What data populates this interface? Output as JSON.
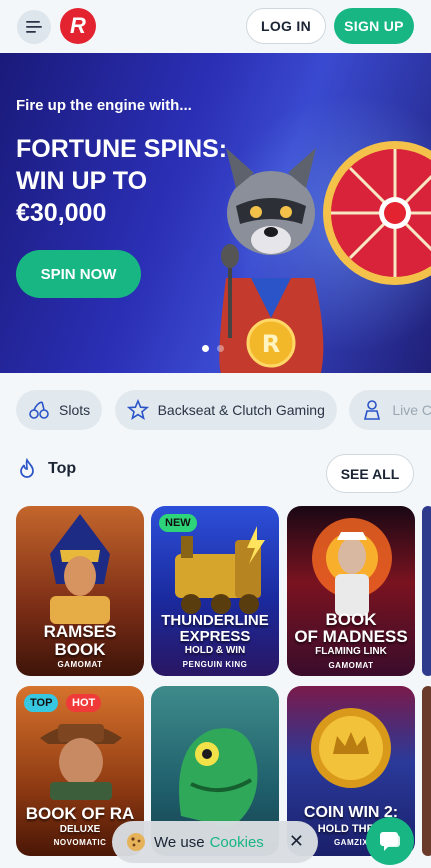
{
  "header": {
    "login_label": "LOG IN",
    "signup_label": "SIGN UP"
  },
  "hero": {
    "subtitle": "Fire up the engine with...",
    "title_line1": "FORTUNE SPINS:",
    "title_line2": "WIN UP TO",
    "title_line3": "€30,000",
    "cta_label": "SPIN NOW"
  },
  "categories": [
    {
      "label": "Slots",
      "icon": "cherries-icon"
    },
    {
      "label": "Backseat & Clutch Gaming",
      "icon": "star-icon"
    },
    {
      "label": "Live Ca",
      "icon": "dealer-icon"
    }
  ],
  "section": {
    "title": "Top",
    "see_all_label": "SEE ALL"
  },
  "games": [
    {
      "name1": "RAMSES",
      "name2": "BOOK",
      "maker": "GAMOMAT",
      "badges": []
    },
    {
      "name1": "THUNDERLINE",
      "name2": "EXPRESS",
      "sub": "HOLD & WIN",
      "maker": "PENGUIN KING",
      "badges": [
        "NEW"
      ]
    },
    {
      "name1": "BOOK",
      "name2": "OF MADNESS",
      "sub": "FLAMING LINK",
      "maker": "GAMOMAT",
      "badges": []
    },
    {
      "name1": "BOOK OF RA",
      "sub": "DELUXE",
      "maker": "NOVOMATIC",
      "badges": [
        "TOP",
        "HOT"
      ]
    },
    {
      "name1": "",
      "badges": []
    },
    {
      "name1": "COIN WIN 2:",
      "sub": "HOLD THE S",
      "maker": "GAMZIX",
      "badges": []
    }
  ],
  "cookie": {
    "text": "We use",
    "link": "Cookies",
    "close": "✕"
  },
  "colors": {
    "accent": "#18b683",
    "brand": "#e3232f",
    "badge_new": "#2ed47a",
    "badge_top": "#38c7e0",
    "badge_hot": "#f03a3a"
  }
}
